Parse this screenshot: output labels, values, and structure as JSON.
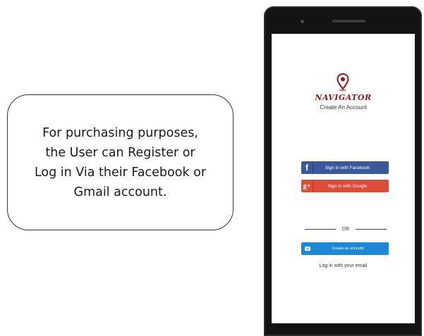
{
  "callout": {
    "text": "For purchasing purposes,\nthe User can Register or\nLog in Via their Facebook or\nGmail account."
  },
  "app": {
    "logo_text": "NAVIGATOR",
    "subtitle": "Create An Account",
    "brand_color": "#8b1a1a"
  },
  "buttons": {
    "facebook": {
      "icon": "f",
      "label": "Sign in with Facebook",
      "color": "#3b5998"
    },
    "google": {
      "icon": "g+",
      "label": "Sign in with Google",
      "color": "#dd4b39"
    },
    "create": {
      "icon": "mail-icon",
      "label": "Create an account",
      "color": "#1e88d6"
    }
  },
  "divider": {
    "text": "OR"
  },
  "email_link": {
    "label": "Log in with your email"
  }
}
